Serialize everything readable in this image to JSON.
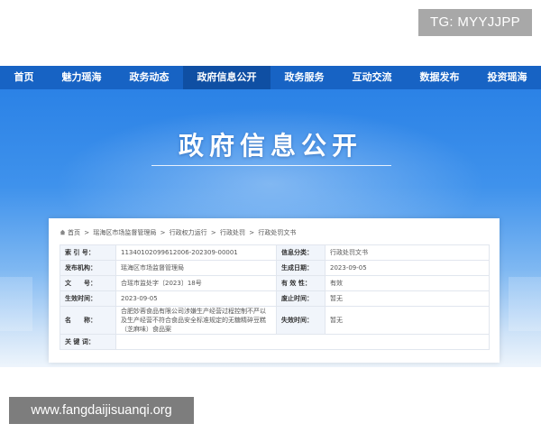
{
  "tag": "TG: MYYJJPP",
  "nav": {
    "items": [
      "首页",
      "魅力瑶海",
      "政务动态",
      "政府信息公开",
      "政务服务",
      "互动交流",
      "数据发布",
      "投资瑶海"
    ],
    "active_index": 3
  },
  "hero": {
    "title": "政府信息公开"
  },
  "breadcrumb": [
    "首页",
    ">",
    "瑶海区市场监督管理局",
    ">",
    "行政权力运行",
    ">",
    "行政处罚",
    ">",
    "行政处罚文书"
  ],
  "info": {
    "index_label": "索 引 号：",
    "index_value": "11340102099612006-202309-00001",
    "category_label": "信息分类：",
    "category_value": "行政处罚文书",
    "publisher_label": "发布机构：",
    "publisher_value": "瑶海区市场监督管理局",
    "created_label": "生成日期：",
    "created_value": "2023-09-05",
    "docno_label": "文　　号：",
    "docno_value": "合瑶市监处字〔2023〕18号",
    "validity_label": "有 效 性：",
    "validity_value": "有效",
    "effective_label": "生效时间：",
    "effective_value": "2023-09-05",
    "abolished_label": "废止时间：",
    "abolished_value": "暂无",
    "name_label": "名　　称：",
    "name_value": "合肥妙蓉食品有限公司涉嫌生产经营过程控制不严以及生产经营不符合食品安全标准规定的无糖精碎豆糕（芝麻味）食品案",
    "expire_label": "失效时间：",
    "expire_value": "暂无",
    "keywords_label": "关 键 词：",
    "keywords_value": ""
  },
  "watermark": "www.fangdaijisuanqi.org",
  "colors": {
    "nav": "#1763c4",
    "nav_active": "#0f4fa3",
    "hero_top": "#2b82e6"
  },
  "icons": {
    "breadcrumb_home": "home-icon"
  }
}
